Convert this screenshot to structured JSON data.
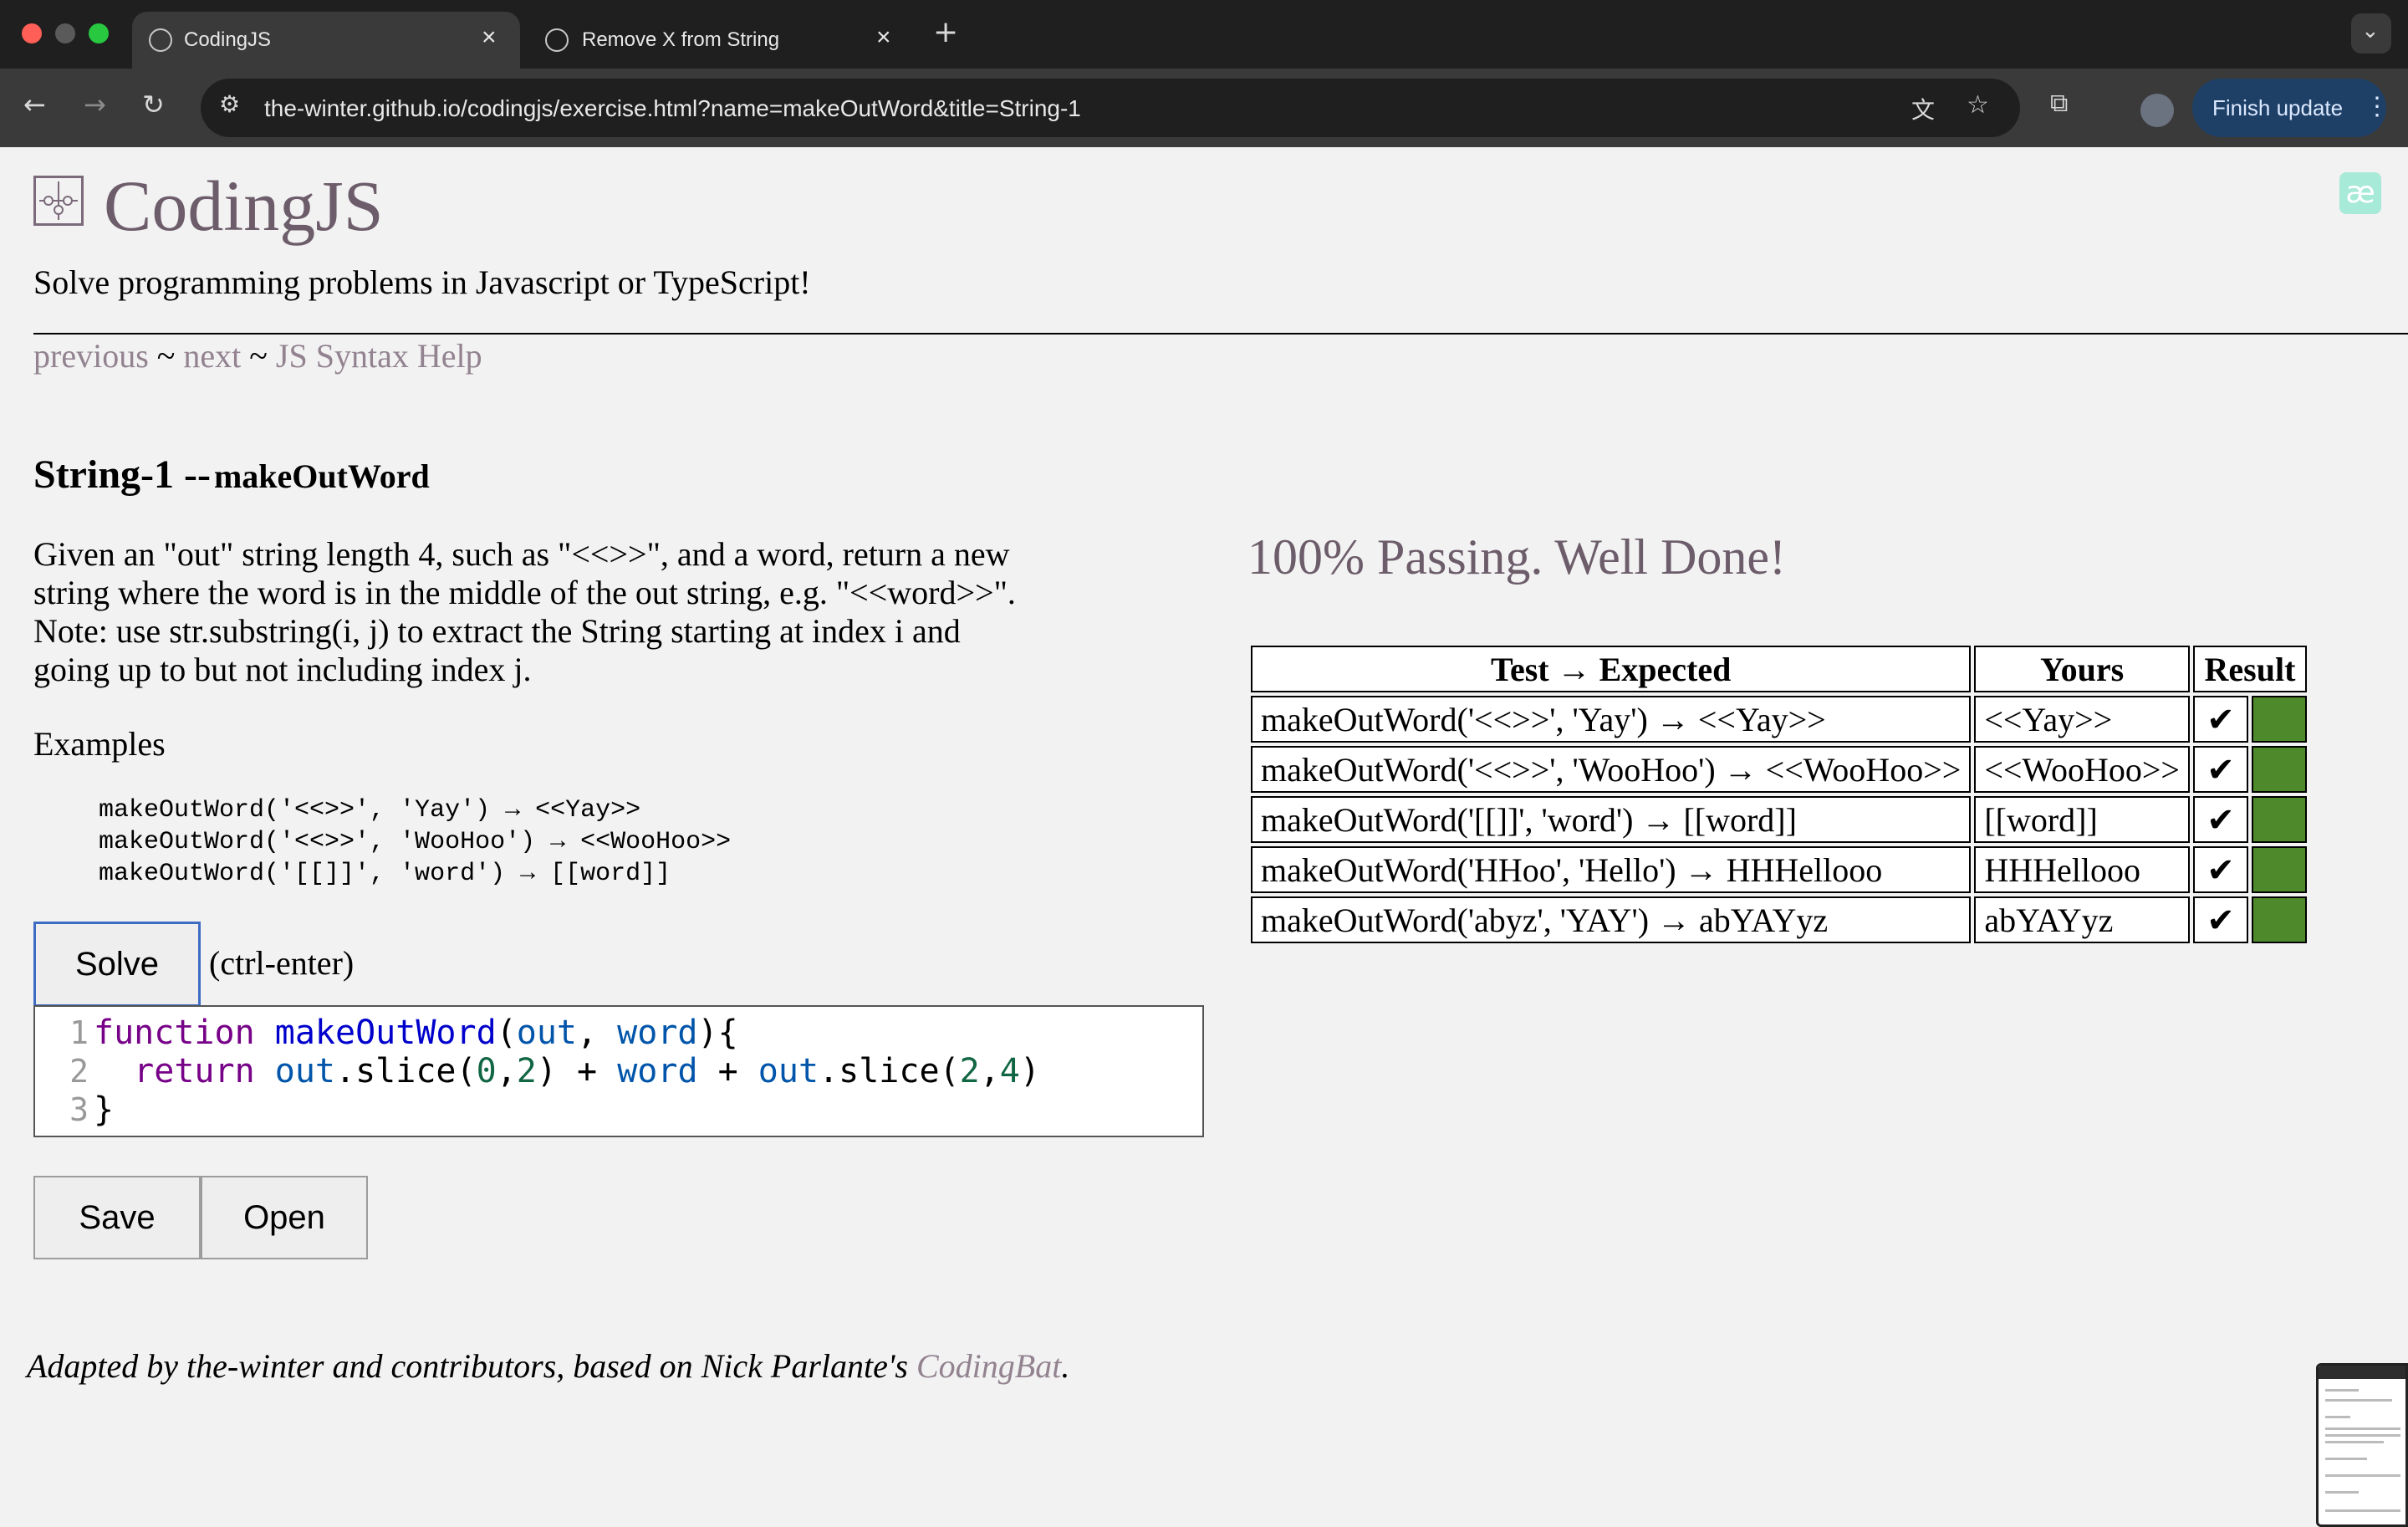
{
  "browser": {
    "tabs": [
      {
        "title": "CodingJS",
        "active": true
      },
      {
        "title": "Remove X from String",
        "active": false
      }
    ],
    "url": "the-winter.github.io/codingjs/exercise.html?name=makeOutWord&title=String-1",
    "finish_update_label": "Finish update",
    "traffic_colors": [
      "#ff5f57",
      "#5a5a5a",
      "#28c840"
    ]
  },
  "site": {
    "title": "CodingJS",
    "tagline": "Solve programming problems in Javascript or TypeScript!",
    "nav": {
      "previous": "previous",
      "sep1": " ~ ",
      "next": "next",
      "sep2": " ~ ",
      "help": "JS Syntax Help"
    }
  },
  "problem": {
    "category": "String-1 --",
    "name": "makeOutWord",
    "description": "Given an \"out\" string length 4, such as \"<<>>\", and a word, return a new string where the word is in the middle of the out string, e.g. \"<<word>>\". Note: use str.substring(i, j) to extract the String starting at index i and going up to but not including index j.",
    "examples_heading": "Examples",
    "examples": [
      "makeOutWord('<<>>', 'Yay') → <<Yay>>",
      "makeOutWord('<<>>', 'WooHoo') → <<WooHoo>>",
      "makeOutWord('[[]]', 'word') → [[word]]"
    ]
  },
  "editor": {
    "solve_label": "Solve",
    "shortcut": "(ctrl-enter)",
    "line_numbers": [
      "1",
      "2",
      "3"
    ],
    "save_label": "Save",
    "open_label": "Open"
  },
  "results": {
    "status": "100% Passing. Well Done!",
    "headers": [
      "Test → Expected",
      "Yours",
      "Result"
    ],
    "rows": [
      {
        "test": "makeOutWord('<<>>', 'Yay') → <<Yay>>",
        "yours": "<<Yay>>",
        "mark": "✔"
      },
      {
        "test": "makeOutWord('<<>>', 'WooHoo') → <<WooHoo>>",
        "yours": "<<WooHoo>>",
        "mark": "✔"
      },
      {
        "test": "makeOutWord('[[]]', 'word') → [[word]]",
        "yours": "[[word]]",
        "mark": "✔"
      },
      {
        "test": "makeOutWord('HHoo', 'Hello') → HHHellooo",
        "yours": "HHHellooo",
        "mark": "✔"
      },
      {
        "test": "makeOutWord('abyz', 'YAY') → abYAYyz",
        "yours": "abYAYyz",
        "mark": "✔"
      }
    ],
    "pass_color": "#4e8a2b"
  },
  "footer": {
    "text": "Adapted by the-winter and contributors, based on Nick Parlante's ",
    "link": "CodingBat",
    "end": "."
  }
}
